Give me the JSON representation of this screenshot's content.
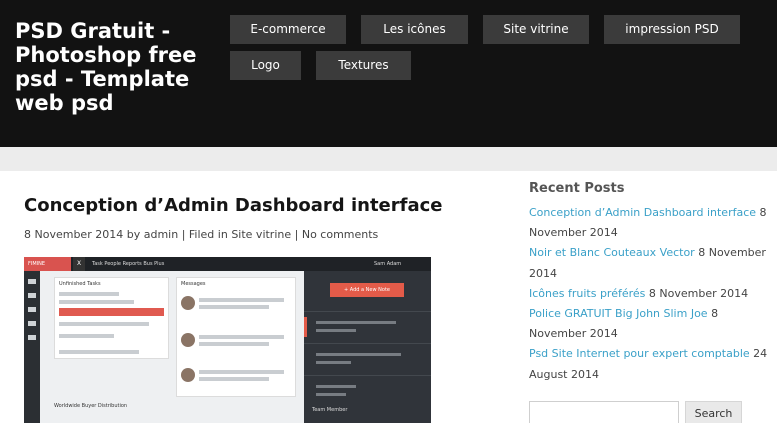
{
  "site": {
    "title": "PSD Gratuit - Photoshop free psd - Template web psd"
  },
  "nav": {
    "items": [
      "E-commerce",
      "Les icônes",
      "Site vitrine",
      "impression PSD",
      "Logo",
      "Textures"
    ]
  },
  "post": {
    "title": "Conception d’Admin Dashboard interface",
    "date": "8 November 2014",
    "by": "by",
    "author": "admin",
    "filed_in_prefix": "| Filed in",
    "category": "Site vitrine",
    "separator": "|",
    "comments": "No comments"
  },
  "image": {
    "brand": "FIMINE",
    "x_label": "X",
    "top_links": "Task   People   Reports   Bus Plus",
    "user": "Sam Adam",
    "tasks_title": "Unfinished Tasks",
    "messages_title": "Messages",
    "new_note": "+ Add a New Note",
    "widget_title": "Worldwide Buyer Distribution",
    "team_title": "Team Member"
  },
  "recent_posts": {
    "title": "Recent Posts",
    "items": [
      {
        "link": "Conception d’Admin Dashboard interface",
        "date": "8 November 2014"
      },
      {
        "link": "Noir et Blanc Couteaux Vector",
        "date": "8 November 2014"
      },
      {
        "link": "Icônes fruits préférés",
        "date": "8 November 2014"
      },
      {
        "link": "Police GRATUIT Big John Slim Joe",
        "date": "8 November 2014"
      },
      {
        "link": "Psd Site Internet pour expert comptable",
        "date": "24 August 2014"
      }
    ]
  },
  "search": {
    "button_label": "Search",
    "placeholder": ""
  },
  "colors": {
    "header_bg": "#121212",
    "nav_bg": "#3b3b3b",
    "link": "#3aa0c8",
    "accent_red": "#e35b49"
  }
}
